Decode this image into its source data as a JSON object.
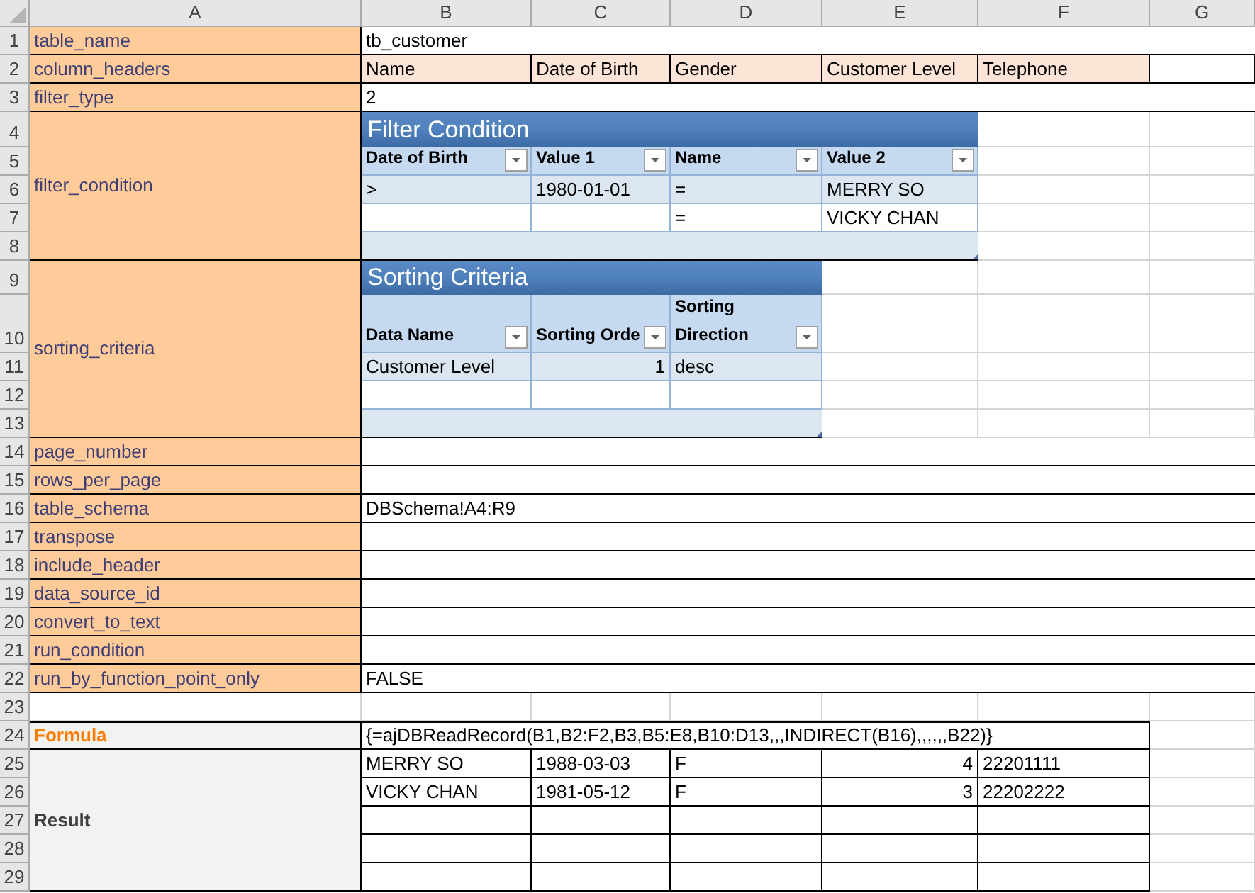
{
  "columns": [
    "A",
    "B",
    "C",
    "D",
    "E",
    "F",
    "G"
  ],
  "row_numbers": [
    "1",
    "2",
    "3",
    "4",
    "5",
    "6",
    "7",
    "8",
    "9",
    "10",
    "11",
    "12",
    "13",
    "14",
    "15",
    "16",
    "17",
    "18",
    "19",
    "20",
    "21",
    "22",
    "23",
    "24",
    "25",
    "26",
    "27",
    "28",
    "29"
  ],
  "parameters": [
    {
      "kind": "text",
      "label": "table_name",
      "value": "tb_customer"
    },
    {
      "kind": "headers",
      "label": "column_headers",
      "values": [
        "Name",
        "Date of Birth",
        "Gender",
        "Customer Level",
        "Telephone"
      ]
    },
    {
      "kind": "text",
      "label": "filter_type",
      "value": "2"
    },
    {
      "kind": "table",
      "label": "filter_condition",
      "table": {
        "title": "Filter Condition",
        "columns": [
          "Date of Birth",
          "Value 1",
          "Name",
          "Value 2"
        ],
        "rows": [
          [
            ">",
            "1980-01-01",
            "=",
            "MERRY SO"
          ],
          [
            null,
            null,
            "=",
            "VICKY CHAN"
          ],
          [
            null,
            null,
            null,
            null
          ]
        ]
      }
    },
    {
      "kind": "table",
      "label": "sorting_criteria",
      "table": {
        "title": "Sorting Criteria",
        "columns": [
          "Data Name",
          "Sorting Orde",
          "Sorting Direction"
        ],
        "numeric_columns": [
          false,
          true,
          false
        ],
        "rows": [
          [
            "Customer Level",
            "1",
            "desc"
          ],
          [
            null,
            null,
            null
          ],
          [
            null,
            null,
            null
          ]
        ]
      }
    },
    {
      "kind": "text",
      "label": "page_number"
    },
    {
      "kind": "text",
      "label": "rows_per_page"
    },
    {
      "kind": "text",
      "label": "table_schema",
      "value": "DBSchema!A4:R9"
    },
    {
      "kind": "text",
      "label": "transpose"
    },
    {
      "kind": "text",
      "label": "include_header"
    },
    {
      "kind": "text",
      "label": "data_source_id"
    },
    {
      "kind": "text",
      "label": "convert_to_text"
    },
    {
      "kind": "text",
      "label": "run_condition"
    },
    {
      "kind": "text",
      "label": "run_by_function_point_only",
      "value": "FALSE"
    }
  ],
  "formula": {
    "label": "Formula",
    "value": "{=ajDBReadRecord(B1,B2:F2,B3,B5:E8,B10:D13,,,INDIRECT(B16),,,,,,B22)}"
  },
  "result": {
    "label": "Result",
    "numeric_columns": [
      false,
      false,
      false,
      true,
      false
    ],
    "rows": [
      [
        "MERRY SO",
        "1988-03-03",
        "F",
        "4",
        "22201111"
      ],
      [
        "VICKY CHAN",
        "1981-05-12",
        "F",
        "3",
        "22202222"
      ],
      [
        null,
        null,
        null,
        null,
        null
      ],
      [
        null,
        null,
        null,
        null,
        null
      ],
      [
        null,
        null,
        null,
        null,
        null
      ]
    ]
  }
}
